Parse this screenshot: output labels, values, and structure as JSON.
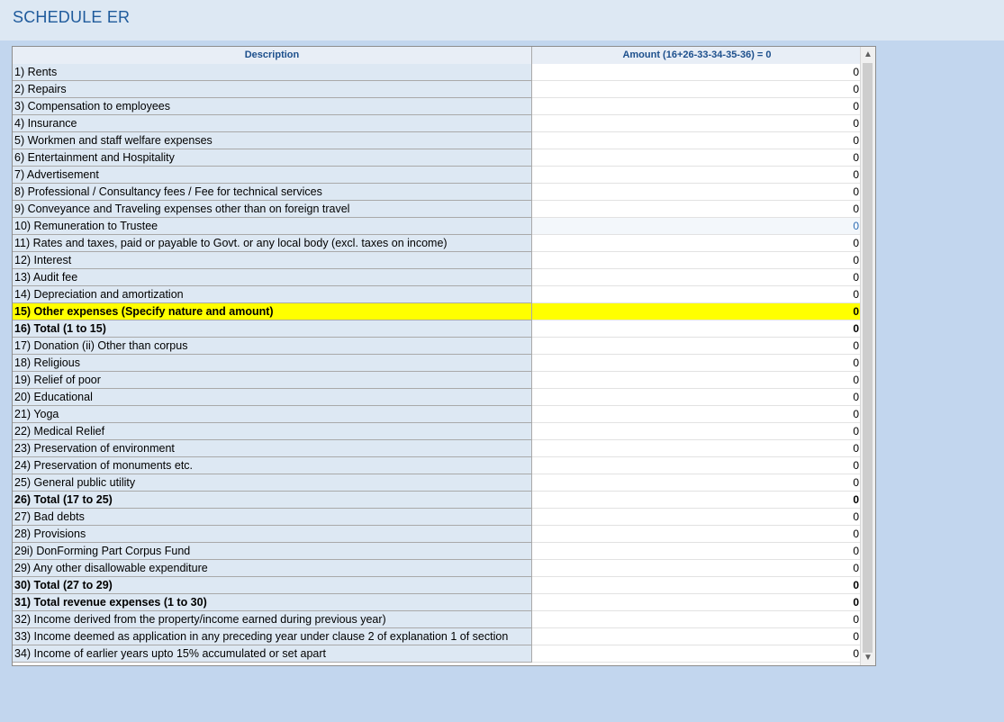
{
  "title": "SCHEDULE ER",
  "table": {
    "header_description": "Description",
    "header_amount": "Amount (16+26-33-34-35-36) = 0",
    "rows": [
      {
        "label": "1) Rents",
        "value": "0"
      },
      {
        "label": "2) Repairs",
        "value": "0"
      },
      {
        "label": "3) Compensation to employees",
        "value": "0"
      },
      {
        "label": "4) Insurance",
        "value": "0"
      },
      {
        "label": "5) Workmen and staff welfare expenses",
        "value": "0"
      },
      {
        "label": "6) Entertainment and Hospitality",
        "value": "0"
      },
      {
        "label": "7) Advertisement",
        "value": "0"
      },
      {
        "label": "8) Professional / Consultancy fees / Fee for technical services",
        "value": "0"
      },
      {
        "label": "9) Conveyance and Traveling expenses other than on foreign travel",
        "value": "0"
      },
      {
        "label": "10) Remuneration to Trustee",
        "value": "0"
      },
      {
        "label": "11) Rates and taxes, paid or payable to Govt. or any local body (excl. taxes on income)",
        "value": "0"
      },
      {
        "label": "12) Interest",
        "value": "0"
      },
      {
        "label": "13) Audit fee",
        "value": "0"
      },
      {
        "label": "14) Depreciation and amortization",
        "value": "0"
      },
      {
        "label": "15) Other expenses  (Specify nature and amount)",
        "value": "0"
      },
      {
        "label": "16) Total (1 to 15)",
        "value": "0"
      },
      {
        "label": "17) Donation (ii) Other than corpus",
        "value": "0"
      },
      {
        "label": "18) Religious",
        "value": "0"
      },
      {
        "label": "19) Relief of poor",
        "value": "0"
      },
      {
        "label": "20) Educational",
        "value": "0"
      },
      {
        "label": "21) Yoga",
        "value": "0"
      },
      {
        "label": "22) Medical Relief",
        "value": "0"
      },
      {
        "label": "23) Preservation of environment",
        "value": "0"
      },
      {
        "label": "24) Preservation of monuments etc.",
        "value": "0"
      },
      {
        "label": "25) General public utility",
        "value": "0"
      },
      {
        "label": "26) Total (17 to 25)",
        "value": "0"
      },
      {
        "label": "27) Bad debts",
        "value": "0"
      },
      {
        "label": "28) Provisions",
        "value": "0"
      },
      {
        "label": "29i) DonForming Part Corpus Fund",
        "value": "0"
      },
      {
        "label": "29) Any other disallowable expenditure",
        "value": "0"
      },
      {
        "label": "30) Total (27 to 29)",
        "value": "0"
      },
      {
        "label": "31) Total revenue expenses (1 to 30)",
        "value": "0"
      },
      {
        "label": "32) Income derived from the property/income earned during previous year)",
        "value": "0"
      },
      {
        "label": "33) Income deemed as application in any preceding year under clause 2 of explanation 1 of section",
        "value": "0"
      },
      {
        "label": "34) Income of earlier years upto 15% accumulated or set apart",
        "value": "0"
      }
    ]
  },
  "scrollbar": {
    "up_icon": "chevron-up-icon",
    "down_icon": "chevron-down-icon"
  }
}
